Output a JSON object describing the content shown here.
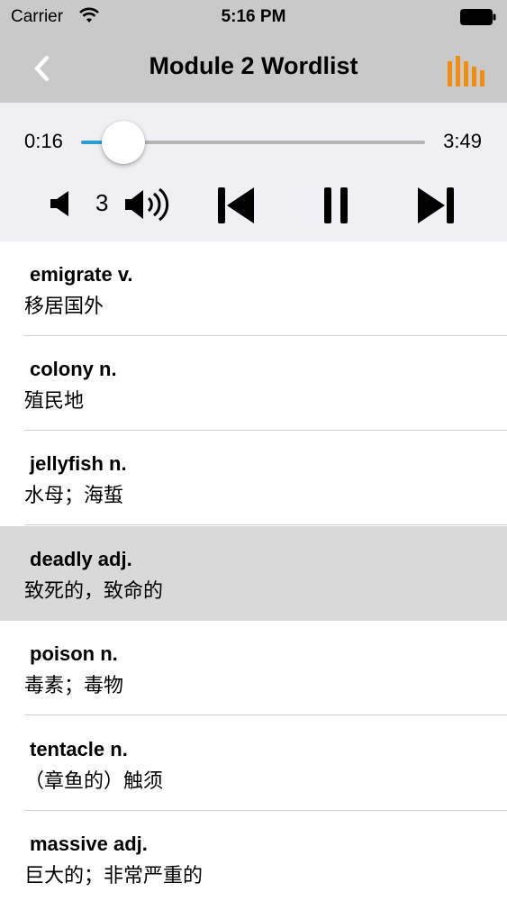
{
  "status_bar": {
    "carrier": "Carrier",
    "time": "5:16 PM",
    "wifi_icon": "wifi-icon",
    "battery_icon": "battery-icon"
  },
  "nav": {
    "title": "Module 2 Wordlist",
    "back_icon": "chevron-left-icon",
    "playlist_icon": "audio-bars-icon",
    "accent_color": "#f28c0f"
  },
  "player": {
    "elapsed": "0:16",
    "total": "3:49",
    "progress": 0.07,
    "volume": "3",
    "progress_color": "#2a9fd6"
  },
  "wordlist": {
    "selected_index": 3,
    "items": [
      {
        "word": "emigrate v.",
        "meaning": "移居国外"
      },
      {
        "word": "colony n.",
        "meaning": "殖民地"
      },
      {
        "word": "jellyfish n.",
        "meaning": "水母；海蜇"
      },
      {
        "word": "deadly adj.",
        "meaning": "致死的，致命的"
      },
      {
        "word": "poison n.",
        "meaning": "毒素；毒物"
      },
      {
        "word": "tentacle n.",
        "meaning": "（章鱼的）触须"
      },
      {
        "word": "massive adj.",
        "meaning": "巨大的；非常严重的"
      }
    ]
  }
}
